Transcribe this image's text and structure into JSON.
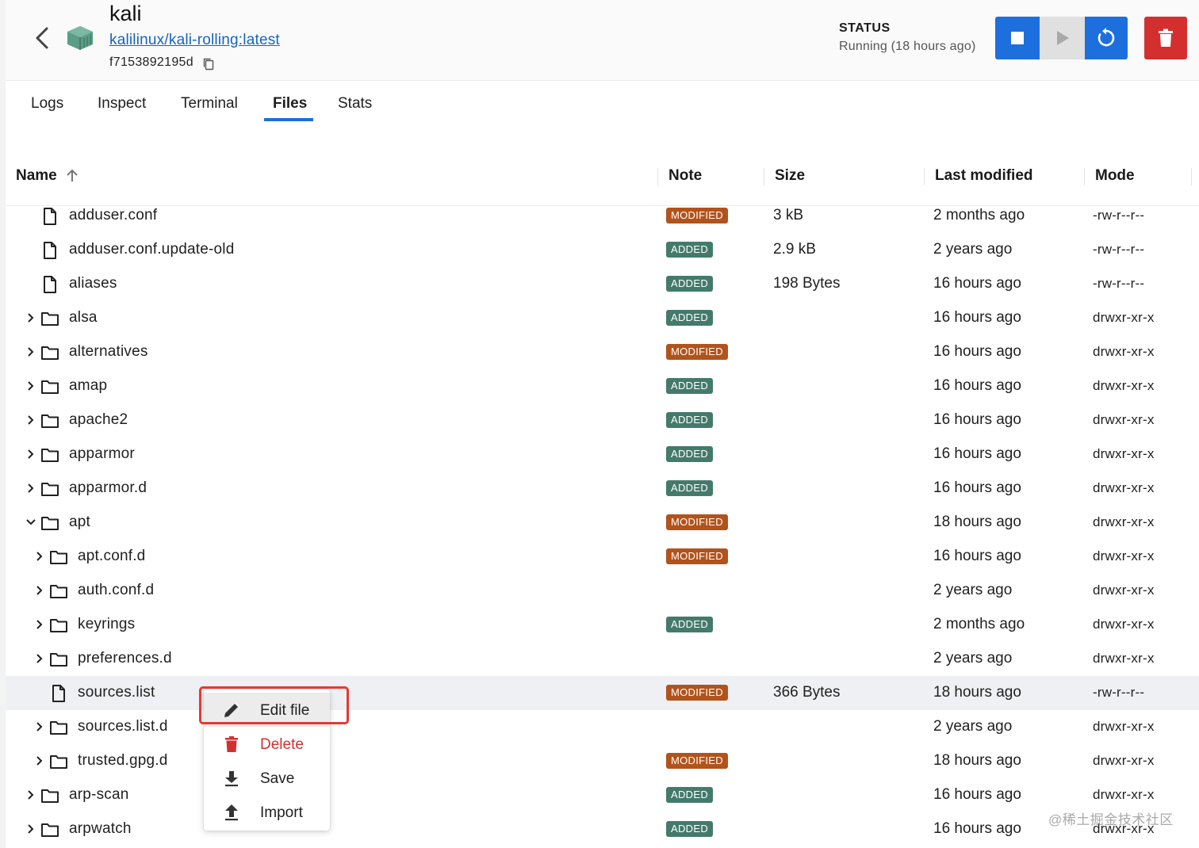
{
  "header": {
    "title": "kali",
    "image": "kalilinux/kali-rolling:latest",
    "container_id": "f7153892195d",
    "status_label": "STATUS",
    "status_value": "Running (18 hours ago)"
  },
  "tabs": [
    {
      "label": "Logs",
      "active": false
    },
    {
      "label": "Inspect",
      "active": false
    },
    {
      "label": "Terminal",
      "active": false
    },
    {
      "label": "Files",
      "active": true
    },
    {
      "label": "Stats",
      "active": false
    }
  ],
  "table": {
    "columns": {
      "name": "Name",
      "note": "Note",
      "size": "Size",
      "last_modified": "Last modified",
      "mode": "Mode"
    },
    "sort": {
      "column": "Name",
      "direction": "ascending"
    },
    "rows": [
      {
        "name": "adduser.conf",
        "type": "file",
        "depth": 0,
        "note": "MODIFIED",
        "size": "3 kB",
        "modified": "2 months ago",
        "mode": "-rw-r--r--"
      },
      {
        "name": "adduser.conf.update-old",
        "type": "file",
        "depth": 0,
        "note": "ADDED",
        "size": "2.9 kB",
        "modified": "2 years ago",
        "mode": "-rw-r--r--"
      },
      {
        "name": "aliases",
        "type": "file",
        "depth": 0,
        "note": "ADDED",
        "size": "198 Bytes",
        "modified": "16 hours ago",
        "mode": "-rw-r--r--"
      },
      {
        "name": "alsa",
        "type": "folder",
        "depth": 0,
        "expanded": false,
        "note": "ADDED",
        "size": "",
        "modified": "16 hours ago",
        "mode": "drwxr-xr-x"
      },
      {
        "name": "alternatives",
        "type": "folder",
        "depth": 0,
        "expanded": false,
        "note": "MODIFIED",
        "size": "",
        "modified": "16 hours ago",
        "mode": "drwxr-xr-x"
      },
      {
        "name": "amap",
        "type": "folder",
        "depth": 0,
        "expanded": false,
        "note": "ADDED",
        "size": "",
        "modified": "16 hours ago",
        "mode": "drwxr-xr-x"
      },
      {
        "name": "apache2",
        "type": "folder",
        "depth": 0,
        "expanded": false,
        "note": "ADDED",
        "size": "",
        "modified": "16 hours ago",
        "mode": "drwxr-xr-x"
      },
      {
        "name": "apparmor",
        "type": "folder",
        "depth": 0,
        "expanded": false,
        "note": "ADDED",
        "size": "",
        "modified": "16 hours ago",
        "mode": "drwxr-xr-x"
      },
      {
        "name": "apparmor.d",
        "type": "folder",
        "depth": 0,
        "expanded": false,
        "note": "ADDED",
        "size": "",
        "modified": "16 hours ago",
        "mode": "drwxr-xr-x"
      },
      {
        "name": "apt",
        "type": "folder",
        "depth": 0,
        "expanded": true,
        "note": "MODIFIED",
        "size": "",
        "modified": "18 hours ago",
        "mode": "drwxr-xr-x"
      },
      {
        "name": "apt.conf.d",
        "type": "folder",
        "depth": 1,
        "expanded": false,
        "note": "MODIFIED",
        "size": "",
        "modified": "16 hours ago",
        "mode": "drwxr-xr-x"
      },
      {
        "name": "auth.conf.d",
        "type": "folder",
        "depth": 1,
        "expanded": false,
        "note": "",
        "size": "",
        "modified": "2 years ago",
        "mode": "drwxr-xr-x"
      },
      {
        "name": "keyrings",
        "type": "folder",
        "depth": 1,
        "expanded": false,
        "note": "ADDED",
        "size": "",
        "modified": "2 months ago",
        "mode": "drwxr-xr-x"
      },
      {
        "name": "preferences.d",
        "type": "folder",
        "depth": 1,
        "expanded": false,
        "note": "",
        "size": "",
        "modified": "2 years ago",
        "mode": "drwxr-xr-x"
      },
      {
        "name": "sources.list",
        "type": "file",
        "depth": 1,
        "selected": true,
        "note": "MODIFIED",
        "size": "366 Bytes",
        "modified": "18 hours ago",
        "mode": "-rw-r--r--"
      },
      {
        "name": "sources.list.d",
        "type": "folder",
        "depth": 1,
        "expanded": false,
        "note": "",
        "size": "",
        "modified": "2 years ago",
        "mode": "drwxr-xr-x"
      },
      {
        "name": "trusted.gpg.d",
        "type": "folder",
        "depth": 1,
        "expanded": false,
        "note": "MODIFIED",
        "size": "",
        "modified": "18 hours ago",
        "mode": "drwxr-xr-x"
      },
      {
        "name": "arp-scan",
        "type": "folder",
        "depth": 0,
        "expanded": false,
        "note": "ADDED",
        "size": "",
        "modified": "16 hours ago",
        "mode": "drwxr-xr-x"
      },
      {
        "name": "arpwatch",
        "type": "folder",
        "depth": 0,
        "expanded": false,
        "note": "ADDED",
        "size": "",
        "modified": "16 hours ago",
        "mode": "drwxr-xr-x"
      }
    ]
  },
  "context_menu": {
    "items": [
      {
        "label": "Edit file",
        "icon": "pencil-icon",
        "danger": false,
        "highlighted": true
      },
      {
        "label": "Delete",
        "icon": "trash-icon",
        "danger": true,
        "highlighted": false
      },
      {
        "label": "Save",
        "icon": "download-icon",
        "danger": false,
        "highlighted": false
      },
      {
        "label": "Import",
        "icon": "upload-icon",
        "danger": false,
        "highlighted": false
      }
    ]
  },
  "watermark": "@稀土掘金技术社区",
  "colors": {
    "primary": "#1d6fdd",
    "danger": "#d32f2f",
    "added_badge": "#447a6b",
    "modified_badge": "#b1531b",
    "annotation_box": "#e53935"
  }
}
